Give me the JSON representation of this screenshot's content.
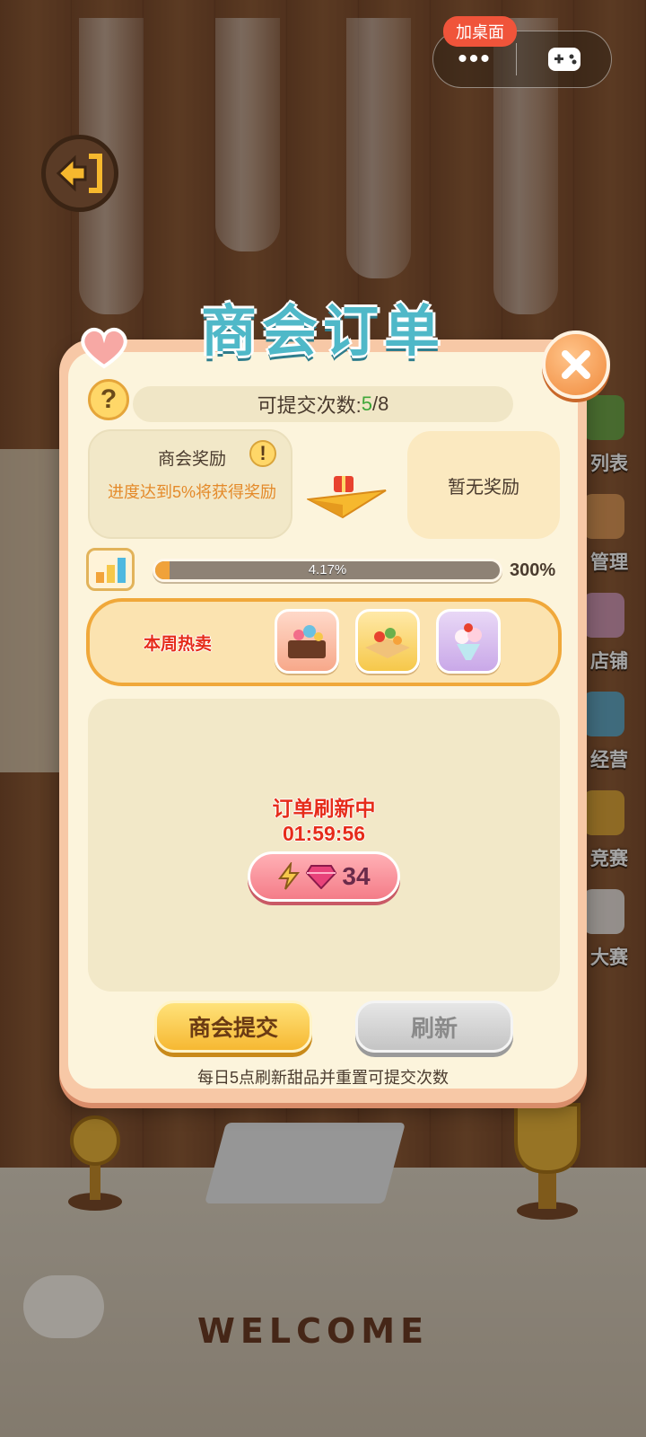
{
  "system": {
    "add_to_desktop": "加桌面",
    "menu_dots": "•••",
    "gamepad_icon": "gamepad-icon"
  },
  "background": {
    "side_menu": [
      {
        "label": "列表"
      },
      {
        "label": "管理"
      },
      {
        "label": "店铺"
      },
      {
        "label": "经营"
      },
      {
        "label": "竞赛"
      },
      {
        "label": "大赛"
      }
    ],
    "welcome_text": "WELCOME"
  },
  "dialog": {
    "title": "商会订单",
    "submit_count": {
      "label": "可提交次数: ",
      "current": "5",
      "separator": "/",
      "total": "8"
    },
    "reward": {
      "title": "商会奖励",
      "description": "进度达到5%将获得奖励",
      "next_reward": "暂无奖励"
    },
    "progress": {
      "value": 0.0417,
      "text": "4.17%",
      "max_text": "300%"
    },
    "hot_sales": {
      "label": "本周热卖",
      "items": [
        {
          "name": "cake-dessert-icon"
        },
        {
          "name": "fruit-tart-icon"
        },
        {
          "name": "ice-cream-sundae-icon"
        }
      ]
    },
    "order_status": {
      "line1": "订单刷新中",
      "countdown": "01:59:56"
    },
    "speedup": {
      "gem_cost": "34"
    },
    "buttons": {
      "submit": "商会提交",
      "refresh": "刷新"
    },
    "footer_note": "每日5点刷新甜品并重置可提交次数"
  },
  "colors": {
    "accent_orange": "#f0a23a",
    "status_red": "#e62c1a",
    "count_green": "#3fa73a",
    "title_teal": "#4fb8c8"
  }
}
